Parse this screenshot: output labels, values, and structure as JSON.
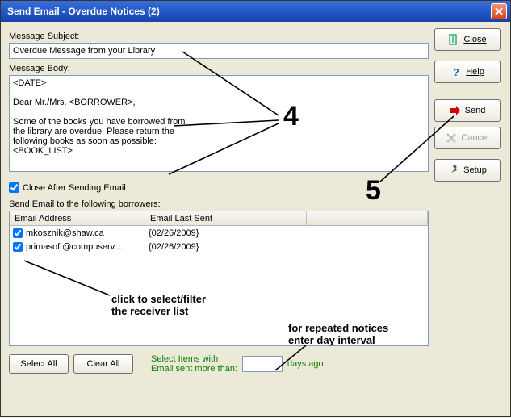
{
  "window": {
    "title": "Send Email - Overdue Notices (2)"
  },
  "labels": {
    "subject": "Message Subject:",
    "body": "Message Body:",
    "close_after": "Close After Sending Email",
    "send_to": "Send Email to the following borrowers:"
  },
  "fields": {
    "subject_value": "Overdue Message from your Library",
    "body_value": "<DATE>\n\nDear Mr./Mrs. <BORROWER>,\n\nSome of the books you have borrowed from\nthe library are overdue. Please return the\nfollowing books as soon as possible:\n<BOOK_LIST>",
    "close_after_checked": true,
    "days_value": ""
  },
  "table": {
    "headers": {
      "email": "Email Address",
      "last_sent": "Email Last Sent"
    },
    "rows": [
      {
        "checked": true,
        "email": "mkosznik@shaw.ca",
        "last_sent": "{02/26/2009}"
      },
      {
        "checked": true,
        "email": "primasoft@compuserv...",
        "last_sent": "{02/26/2009}"
      }
    ]
  },
  "buttons": {
    "select_all": "Select All",
    "clear_all": "Clear All",
    "close": "Close",
    "help": "Help",
    "send": "Send",
    "cancel": "Cancel",
    "setup": "Setup"
  },
  "filter": {
    "line1": "Select Items with",
    "line2": "Email sent more than:",
    "days_suffix": "days ago.."
  },
  "annotations": {
    "num4": "4",
    "num5": "5",
    "receiver_l1": "click to select/filter",
    "receiver_l2": "the receiver list",
    "repeat_l1": "for repeated notices",
    "repeat_l2": "enter day interval"
  }
}
